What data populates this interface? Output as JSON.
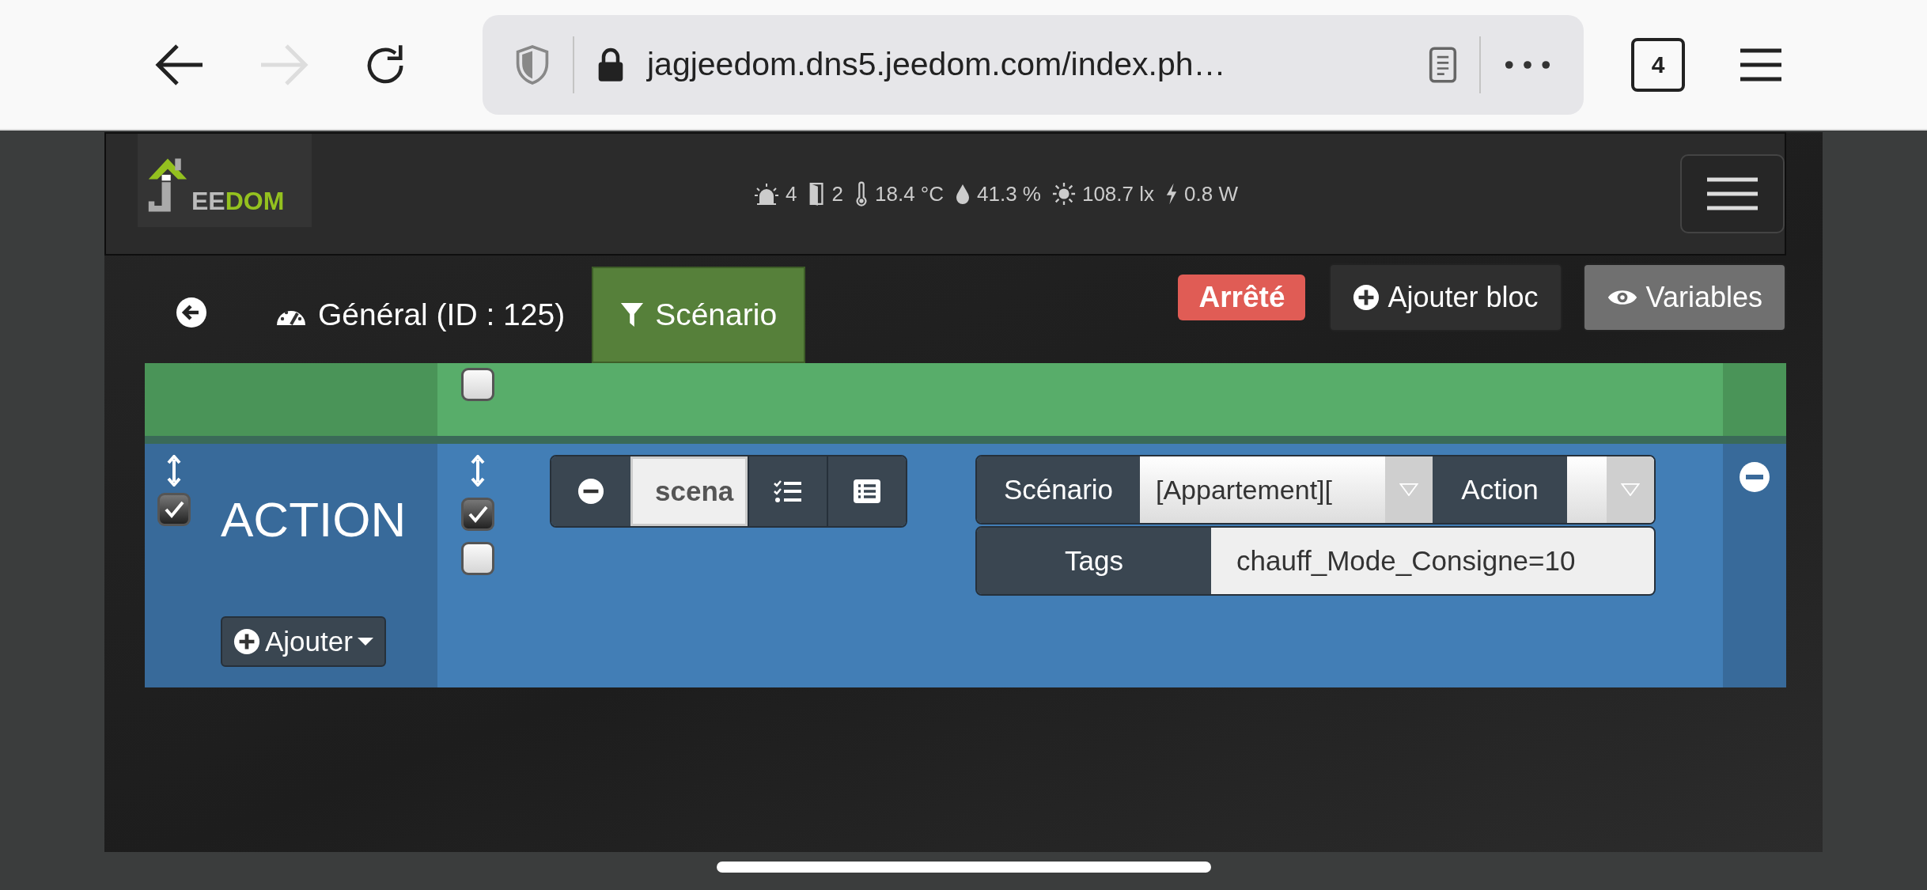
{
  "browser": {
    "url": "jagjeedom.dns5.jeedom.com/index.ph…",
    "tab_count": "4"
  },
  "header": {
    "logo": [
      "EE",
      "DOM"
    ],
    "status": [
      {
        "kind": "alarm",
        "value": "4"
      },
      {
        "kind": "door",
        "value": "2"
      },
      {
        "kind": "temperature",
        "value": "18.4 °C"
      },
      {
        "kind": "humidity",
        "value": "41.3 %"
      },
      {
        "kind": "light",
        "value": "108.7 lx"
      },
      {
        "kind": "power",
        "value": "0.8 W"
      }
    ]
  },
  "tabs": [
    {
      "label": "Général (ID : 125)",
      "kind": "general",
      "selected": false
    },
    {
      "label": "Scénario",
      "kind": "scenario",
      "selected": true
    }
  ],
  "state_badge": "Arrêté",
  "buttons": [
    {
      "label": "Ajouter bloc",
      "kind": "add"
    },
    {
      "label": "Variables",
      "kind": "view"
    }
  ],
  "blocks": [
    {
      "kind": "condition",
      "checkboxes": [
        {
          "checked": false
        }
      ]
    },
    {
      "kind": "action",
      "title": "ACTION",
      "checked": true,
      "add_button": "Ajouter",
      "checkboxes": [
        {
          "checked": true
        },
        {
          "checked": false
        }
      ],
      "command": "scena",
      "fields": {
        "scenario_label": "Scénario",
        "scenario_value": "[Appartement][",
        "action_label": "Action",
        "tags_label": "Tags",
        "tags_value": "chauff_Mode_Consigne=10"
      }
    }
  ]
}
